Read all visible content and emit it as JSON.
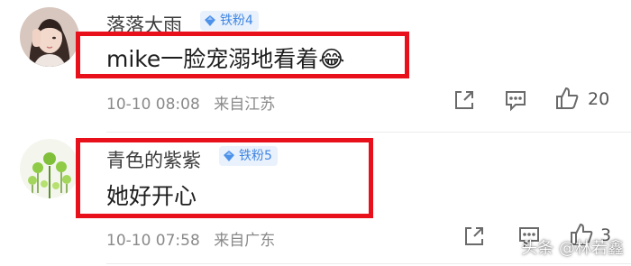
{
  "colors": {
    "highlight": "#e8101b",
    "badge_text": "#3f86e2",
    "badge_bg": "#e9f1fc",
    "meta_text": "#8a8a8a"
  },
  "comments": [
    {
      "username": "落落大雨",
      "badge": "铁粉4",
      "text": "mike一脸宠溺地看着😂",
      "date": "10-10 08:08",
      "location": "来自江苏",
      "like_count": "20",
      "icons": [
        "share-icon",
        "comment-icon",
        "thumbs-up-icon"
      ]
    },
    {
      "username": "青色的紫紫",
      "badge": "铁粉5",
      "text": "她好开心",
      "date": "10-10 07:58",
      "location": "来自广东",
      "like_count": "3",
      "icons": [
        "share-icon",
        "comment-icon",
        "thumbs-up-icon"
      ]
    }
  ],
  "watermark": "头条 @林若鑫"
}
